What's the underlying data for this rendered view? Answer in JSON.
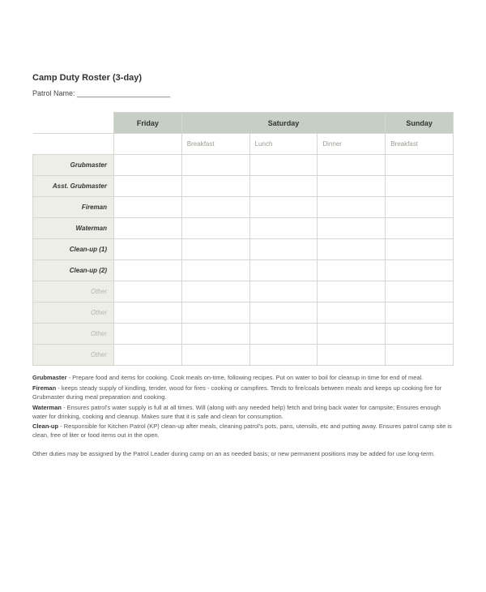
{
  "header": {
    "title": "Camp Duty Roster (3-day)",
    "patrol_label": "Patrol Name: _______________________"
  },
  "table": {
    "days": {
      "fri": "Friday",
      "sat": "Saturday",
      "sun": "Sunday"
    },
    "meals": {
      "breakfast": "Breakfast",
      "lunch": "Lunch",
      "dinner": "Dinner"
    },
    "rows": {
      "grubmaster": "Grubmaster",
      "asst_grub": "Asst. Grubmaster",
      "fireman": "Fireman",
      "waterman": "Waterman",
      "cleanup1": "Clean-up (1)",
      "cleanup2": "Clean-up (2)",
      "other": "Other"
    }
  },
  "desc": {
    "grubmaster": {
      "role": "Grubmaster",
      "text": " - Prepare food and items for cooking. Cook meals on-time, following recipes. Put on water to boil for cleanup in time for end of meal."
    },
    "fireman": {
      "role": "Fireman",
      "text": " - keeps steady supply of kindling, tender, wood for fires - cooking or campfires. Tends to fire/coals between meals and keeps up cooking fire for Grubmaster during meal preparation and cooking."
    },
    "waterman": {
      "role": "Waterman",
      "text": " - Ensures patrol's water supply is full at all times. Will (along with any needed help) fetch and bring back water for campsite; Ensures enough water for drinking, cooking and cleanup. Makes sure that it is safe and clean for consumption."
    },
    "cleanup": {
      "role": "Clean-up",
      "text": " - Responsible for Kitchen Patrol (KP) clean-up after meals, cleaning patrol's pots, pans, utensils, etc and putting away. Ensures patrol camp site is clean, free of liter or food items out in the open."
    }
  },
  "note": "Other duties may be assigned by the Patrol Leader during camp on an as needed basis; or new permanent positions may be added for use long-term."
}
